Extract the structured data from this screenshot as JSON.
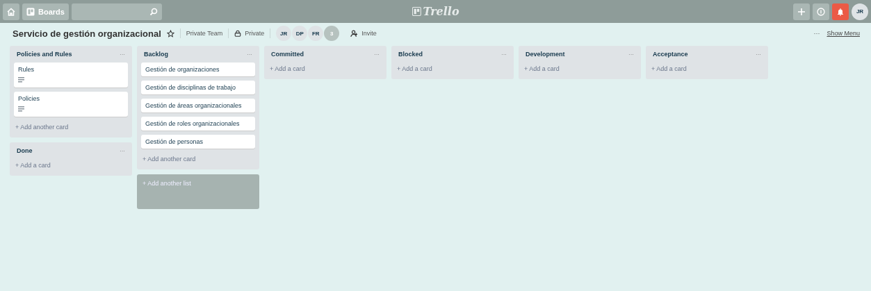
{
  "top_bar": {
    "boards_label": "Boards",
    "logo_text": "Trello",
    "profile": "JR"
  },
  "board_header": {
    "title": "Servicio de gestión organizacional",
    "team": "Private Team",
    "visibility": "Private",
    "members": [
      "JR",
      "DP",
      "FR"
    ],
    "more_members": "3",
    "invite": "Invite",
    "menu_dots": "···",
    "show_menu": "Show Menu"
  },
  "columns": [
    {
      "lists": [
        {
          "kind": "list",
          "title": "Policies and Rules",
          "menu": "···",
          "cards": [
            {
              "text": "Rules",
              "has_description": true
            },
            {
              "text": "Policies",
              "has_description": true
            }
          ],
          "add": "+ Add another card"
        },
        {
          "kind": "list",
          "title": "Done",
          "menu": "···",
          "add": "+ Add a card"
        }
      ]
    },
    {
      "lists": [
        {
          "kind": "list",
          "title": "Backlog",
          "menu": "···",
          "cards": [
            {
              "text": "Gestión de organizaciones",
              "has_description": false
            },
            {
              "text": "Gestión de disciplinas de trabajo",
              "has_description": false
            },
            {
              "text": "Gestión de áreas organizacionales",
              "has_description": false
            },
            {
              "text": "Gestión de roles organizacionales",
              "has_description": false
            },
            {
              "text": "Gestión de personas",
              "has_description": false
            }
          ],
          "add": "+ Add another card"
        },
        {
          "kind": "add-list",
          "add": "+ Add another list"
        }
      ]
    },
    {
      "lists": [
        {
          "kind": "list",
          "title": "Committed",
          "menu": "···",
          "add": "+ Add a card"
        }
      ]
    },
    {
      "lists": [
        {
          "kind": "list",
          "title": "Blocked",
          "menu": "···",
          "add": "+ Add a card"
        }
      ]
    },
    {
      "lists": [
        {
          "kind": "list",
          "title": "Development",
          "menu": "···",
          "add": "+ Add a card"
        }
      ]
    },
    {
      "lists": [
        {
          "kind": "list",
          "title": "Acceptance",
          "menu": "···",
          "add": "+ Add a card"
        }
      ]
    }
  ]
}
